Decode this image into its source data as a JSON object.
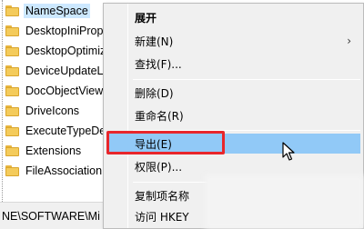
{
  "tree": {
    "items": [
      {
        "label": "NameSpace",
        "selected": true
      },
      {
        "label": "DesktopIniProp"
      },
      {
        "label": "DesktopOptimiz"
      },
      {
        "label": "DeviceUpdateLo"
      },
      {
        "label": "DocObjectView"
      },
      {
        "label": "DriveIcons"
      },
      {
        "label": "ExecuteTypeDel"
      },
      {
        "label": "Extensions"
      },
      {
        "label": "FileAssociation"
      }
    ]
  },
  "statusbar": {
    "path": "NE\\SOFTWARE\\Mi"
  },
  "context_menu": {
    "items": [
      {
        "label": "展开",
        "bold": true
      },
      {
        "label": "新建(N)",
        "submenu": true
      },
      {
        "label": "查找(F)..."
      },
      {
        "separator": true
      },
      {
        "label": "删除(D)"
      },
      {
        "label": "重命名(R)"
      },
      {
        "separator": true
      },
      {
        "label": "导出(E)",
        "hover": true
      },
      {
        "label": "权限(P)..."
      },
      {
        "separator": true
      },
      {
        "label": "复制项名称"
      },
      {
        "label": "访问 HKEY"
      }
    ],
    "submenu_arrow": "›",
    "hover_color": "#91c9f7",
    "highlight_box_color": "#e8262b"
  },
  "icons": {
    "folder": "folder-icon",
    "cursor": "mouse-pointer-icon"
  }
}
